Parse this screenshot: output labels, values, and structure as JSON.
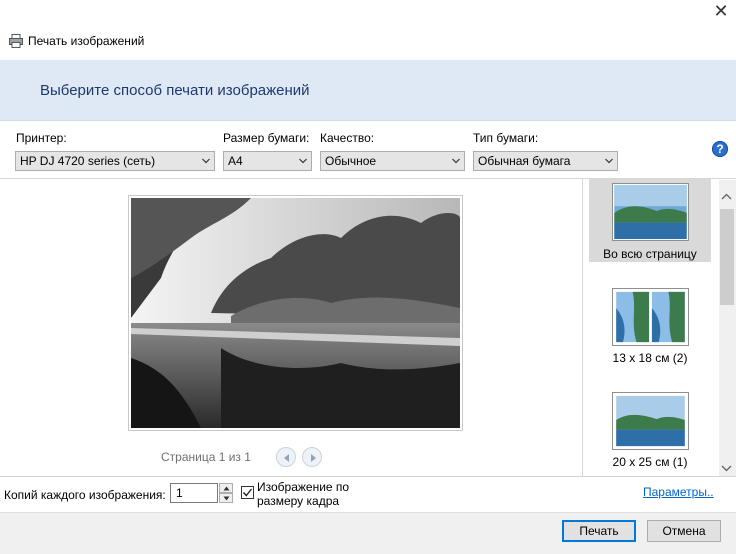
{
  "window": {
    "title": "Печать изображений",
    "close_glyph": "✕"
  },
  "header": {
    "title": "Выберите способ печати изображений"
  },
  "options": {
    "printer": {
      "label": "Принтер:",
      "value": "HP DJ 4720 series (сеть)"
    },
    "paper_size": {
      "label": "Размер бумаги:",
      "value": "A4"
    },
    "quality": {
      "label": "Качество:",
      "value": "Обычное"
    },
    "paper_type": {
      "label": "Тип бумаги:",
      "value": "Обычная бумага"
    },
    "help_glyph": "?"
  },
  "preview": {
    "page_indicator": "Страница 1 из 1"
  },
  "layouts": [
    {
      "label": "Во всю страницу",
      "selected": true
    },
    {
      "label": "13 x 18 см (2)",
      "selected": false
    },
    {
      "label": "20 x 25 см (1)",
      "selected": false
    }
  ],
  "bottom": {
    "copies_label": "Копий каждого изображения:",
    "copies_value": "1",
    "fit_label": "Изображение по размеру кадра",
    "fit_checked": true,
    "params_link": "Параметры.."
  },
  "buttons": {
    "print": "Печать",
    "cancel": "Отмена"
  },
  "colors": {
    "header_bg": "#dfe9f5",
    "header_text": "#1e3a6d",
    "link": "#0066cc",
    "accent": "#0078d7"
  }
}
